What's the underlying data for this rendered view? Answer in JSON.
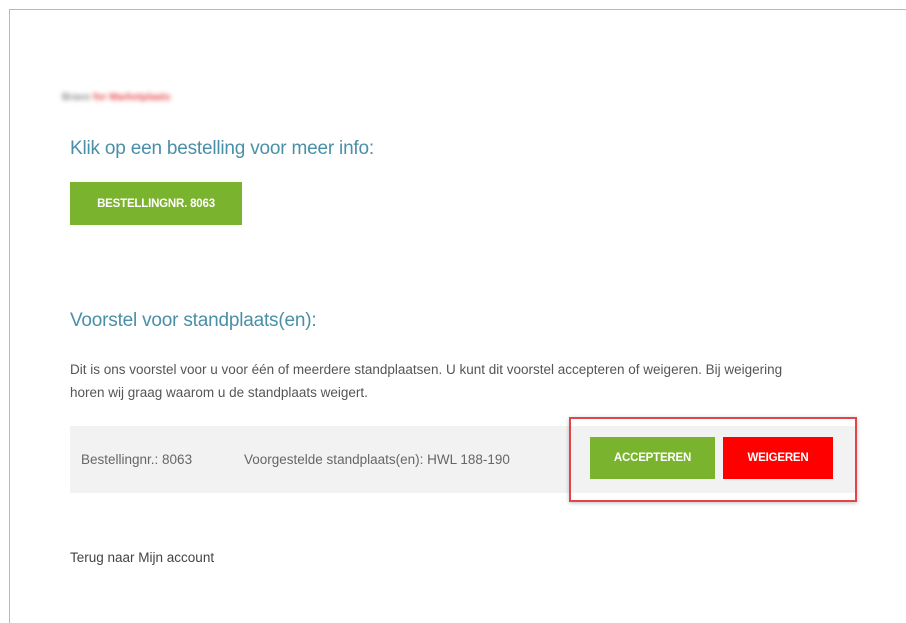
{
  "breadcrumb": {
    "part1": "Bravo",
    "part2": "for Marketplaats"
  },
  "orders_section": {
    "heading": "Klik op een bestelling voor meer info:",
    "order_button_label": "BESTELLINGNR. 8063"
  },
  "proposal_section": {
    "heading": "Voorstel voor standplaats(en):",
    "intro": "Dit is ons voorstel voor u voor één of meerdere standplaatsen. U kunt dit voorstel accepteren of weigeren. Bij weigering horen wij graag waarom u de standplaats weigert.",
    "row": {
      "order_number": "Bestellingnr.: 8063",
      "proposed_spots": "Voorgestelde standplaats(en): HWL 188-190"
    },
    "accept_label": "ACCEPTEREN",
    "decline_label": "WEIGEREN"
  },
  "back_link": "Terug naar Mijn account",
  "colors": {
    "heading": "#4a8fa8",
    "accept_green": "#7ab32e",
    "decline_red": "#ff0000",
    "highlight": "#e0454a"
  }
}
